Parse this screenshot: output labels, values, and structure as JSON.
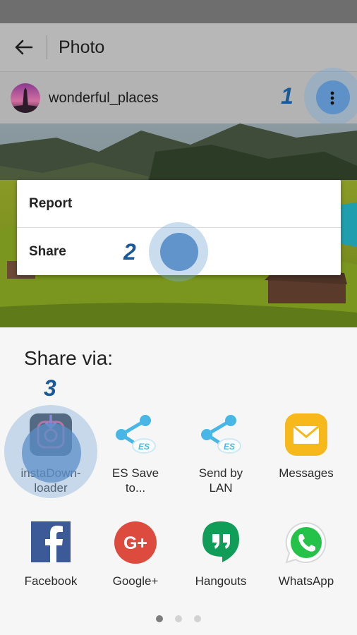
{
  "appbar": {
    "title": "Photo"
  },
  "post": {
    "username": "wonderful_places"
  },
  "menu": {
    "items": [
      "Report",
      "Share"
    ]
  },
  "steps": [
    "1",
    "2",
    "3"
  ],
  "share": {
    "title": "Share via:",
    "apps": [
      {
        "label": "instaDown-\nloader",
        "icon": "instadownloader-icon"
      },
      {
        "label": "ES Save\nto...",
        "icon": "es-save-icon"
      },
      {
        "label": "Send by\nLAN",
        "icon": "es-lan-icon"
      },
      {
        "label": "Messages",
        "icon": "messages-icon"
      },
      {
        "label": "Facebook",
        "icon": "facebook-icon"
      },
      {
        "label": "Google+",
        "icon": "google-plus-icon"
      },
      {
        "label": "Hangouts",
        "icon": "hangouts-icon"
      },
      {
        "label": "WhatsApp",
        "icon": "whatsapp-icon"
      }
    ],
    "pager": {
      "pages": 3,
      "current": 1
    }
  },
  "colors": {
    "highlight": "#5b8fc7",
    "step_number": "#1a5a99"
  }
}
